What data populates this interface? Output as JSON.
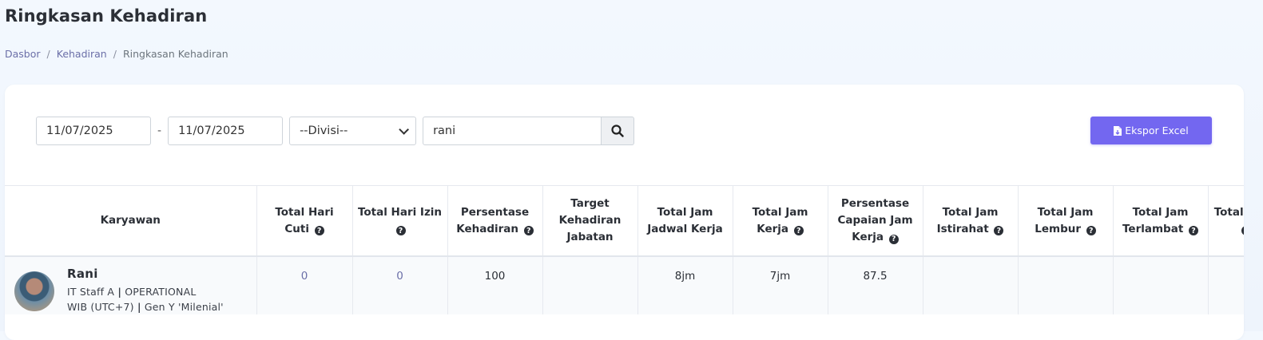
{
  "page": {
    "title": "Ringkasan Kehadiran",
    "breadcrumb": [
      "Dasbor",
      "Kehadiran",
      "Ringkasan Kehadiran"
    ]
  },
  "filters": {
    "date_from": "11/07/2025",
    "range_separator": "-",
    "date_to": "11/07/2025",
    "division_selected": "--Divisi--",
    "search_value": "rani"
  },
  "toolbar": {
    "export_label": "Ekspor Excel",
    "export_icon": "file-export-icon"
  },
  "table": {
    "columns": [
      {
        "label": "Karyawan",
        "help": false
      },
      {
        "label": "Total Hari Cuti",
        "help": true
      },
      {
        "label": "Total Hari Izin",
        "help": true
      },
      {
        "label": "Persentase Kehadiran",
        "help": true
      },
      {
        "label": "Target Kehadiran Jabatan",
        "help": false
      },
      {
        "label": "Total Jam Jadwal Kerja",
        "help": false
      },
      {
        "label": "Total Jam Kerja",
        "help": true
      },
      {
        "label": "Persentase Capaian Jam Kerja",
        "help": true
      },
      {
        "label": "Total Jam Istirahat",
        "help": true
      },
      {
        "label": "Total Jam Lembur",
        "help": true
      },
      {
        "label": "Total Jam Terlambat",
        "help": true
      },
      {
        "label": "Total Terla",
        "help": true
      }
    ],
    "rows": [
      {
        "employee": {
          "name": "Rani",
          "line1_position": "IT Staff A",
          "line1_division": "OPERATIONAL",
          "line2_timezone": "WIB (UTC+7)",
          "line2_generation": "Gen Y 'Milenial'"
        },
        "cells": [
          "0",
          "0",
          "100",
          "",
          "8jm",
          "7jm",
          "87.5",
          "",
          "",
          "",
          ""
        ]
      }
    ]
  },
  "colors": {
    "accent": "#7367f0",
    "link": "#6b6fa8",
    "page_bg": "#f3f8fe"
  }
}
